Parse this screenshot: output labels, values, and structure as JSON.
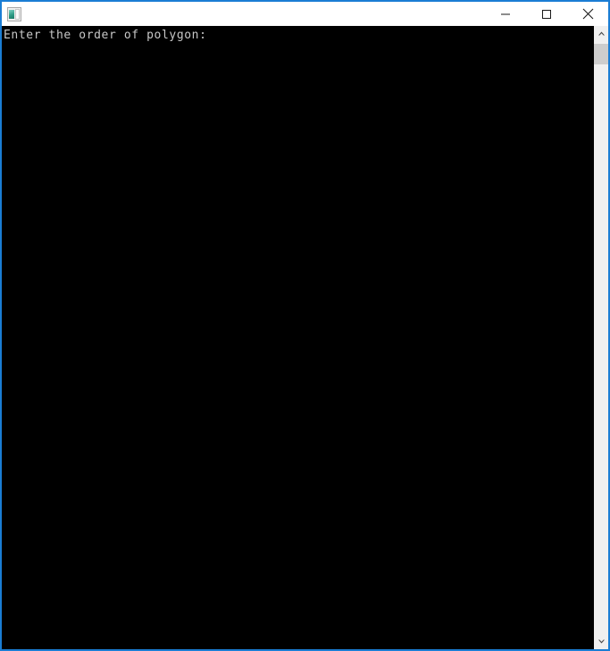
{
  "window": {
    "title": "",
    "icon": "console-app-icon",
    "accent_color": "#1a7dd4",
    "controls": {
      "minimize_label": "Minimize",
      "maximize_label": "Maximize",
      "close_label": "Close"
    }
  },
  "console": {
    "background_color": "#000000",
    "text_color": "#c8c8c8",
    "lines": "Enter the order of polygon:",
    "prompt_text": "Enter the order of polygon:"
  },
  "scrollbar": {
    "up_arrow": "▲",
    "down_arrow": "▼",
    "thumb_color": "#cdcdcd",
    "track_color": "#f0f0f0",
    "position_percent": 0
  }
}
